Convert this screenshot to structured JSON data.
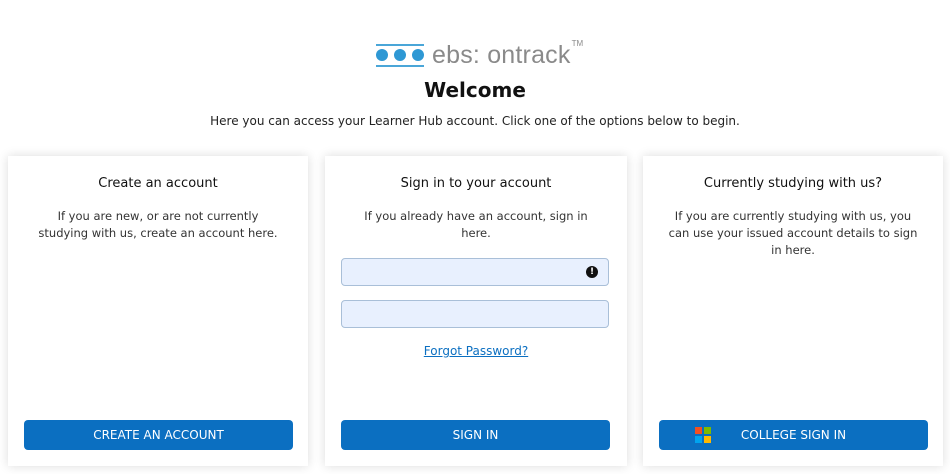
{
  "logo": {
    "text": "ebs: ontrack",
    "tm": "TM"
  },
  "header": {
    "title": "Welcome",
    "subtitle": "Here you can access your Learner Hub account. Click one of the options below to begin."
  },
  "cards": {
    "create": {
      "title": "Create an account",
      "description": "If you are new, or are not currently studying with us, create an account here.",
      "button": "CREATE AN ACCOUNT"
    },
    "signin": {
      "title": "Sign in to your account",
      "description": "If you already have an account, sign in here.",
      "username_value": "",
      "password_value": "",
      "forgot_link": "Forgot Password?",
      "button": "SIGN IN"
    },
    "college": {
      "title": "Currently studying with us?",
      "description": "If you are currently studying with us, you can use your issued account details to sign in here.",
      "button": "COLLEGE SIGN IN"
    }
  },
  "icons": {
    "logo": "three-dots-logo-icon",
    "alert": "exclamation-circle-icon",
    "microsoft": "microsoft-logo-icon"
  },
  "colors": {
    "accent": "#0b6fc1",
    "logo_blue": "#2e98d4",
    "input_bg": "#e8f0fe",
    "ms_red": "#f25022",
    "ms_green": "#7fba00",
    "ms_blue": "#00a4ef",
    "ms_yellow": "#ffb900"
  }
}
